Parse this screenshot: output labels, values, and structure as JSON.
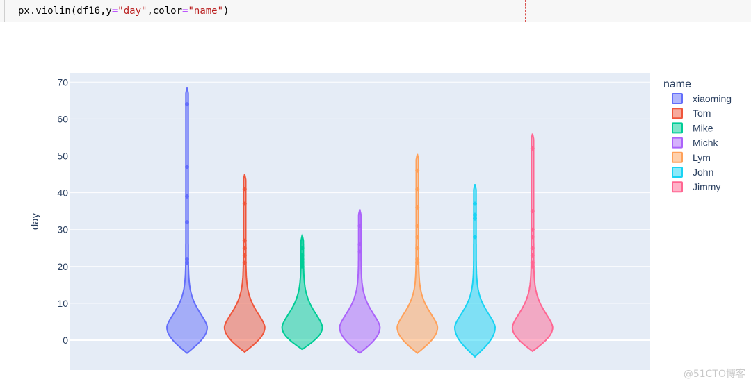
{
  "code_cell": {
    "prefix": "px.violin(df16,y",
    "eq1": "=",
    "str1": "\"day\"",
    "mid": ",color",
    "eq2": "=",
    "str2": "\"name\"",
    "suffix": ")"
  },
  "chart_data": {
    "type": "violin",
    "ylabel": "day",
    "ylim": [
      -8,
      72
    ],
    "yticks": [
      0,
      10,
      20,
      30,
      40,
      50,
      60,
      70
    ],
    "grid": true,
    "legend_title": "name",
    "legend_position": "right",
    "plot_background": "#e5ecf6",
    "series": [
      {
        "name": "xiaoming",
        "color": "#636efa",
        "min": -3.5,
        "max": 68.5,
        "outliers": [
          64,
          47,
          39,
          32,
          22,
          21
        ]
      },
      {
        "name": "Tom",
        "color": "#ef553b",
        "min": -3.2,
        "max": 45,
        "outliers": [
          41,
          37,
          27,
          25,
          23,
          21
        ]
      },
      {
        "name": "Mike",
        "color": "#00cc96",
        "min": -2.5,
        "max": 28.5,
        "outliers": [
          25,
          23,
          22,
          21,
          20
        ]
      },
      {
        "name": "Michk",
        "color": "#ab63fa",
        "min": -3.5,
        "max": 35.5,
        "outliers": [
          31,
          26,
          24
        ]
      },
      {
        "name": "Lym",
        "color": "#ffa15a",
        "min": -3.5,
        "max": 50.5,
        "outliers": [
          46,
          41,
          36,
          31,
          28,
          25,
          22,
          21
        ]
      },
      {
        "name": "John",
        "color": "#19d3f3",
        "min": -4.5,
        "max": 42.3,
        "outliers": [
          37,
          34,
          33,
          28
        ]
      },
      {
        "name": "Jimmy",
        "color": "#ff6692",
        "min": -3.0,
        "max": 56,
        "outliers": [
          52,
          35,
          30,
          28,
          25,
          23,
          21,
          20
        ]
      }
    ]
  },
  "watermark": "@51CTO博客"
}
